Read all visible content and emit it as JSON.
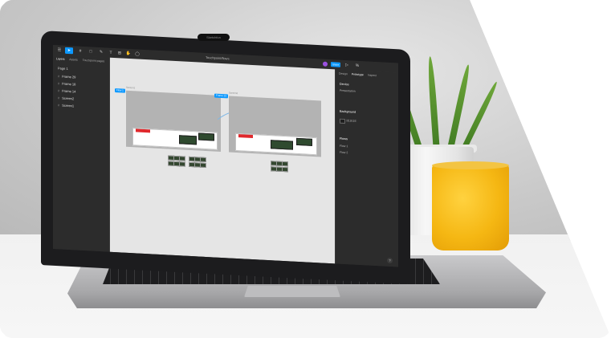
{
  "figma": {
    "camera_label": "Sketchfun",
    "document_title": "Touchpoint/flows",
    "share_label": "Share",
    "left_tabs": [
      "Layers",
      "Assets",
      "Touchpoint pages"
    ],
    "page_name": "Page 1",
    "layers": [
      "Frame 29",
      "Frame 18",
      "Frame 14",
      "Screen2",
      "Screen1"
    ],
    "right_tabs": [
      "Design",
      "Prototype",
      "Inspect"
    ],
    "device_label": "Device",
    "device_value": "Presentation",
    "background_label": "Background",
    "background_value": "1E1E1E",
    "flows_label": "Flows",
    "flows": [
      "Flow 1",
      "Flow 2"
    ],
    "frame_labels": [
      "Screen1",
      "Screen2"
    ],
    "selection_tags": [
      "Flow 1",
      "Frame 13"
    ],
    "help_label": "?"
  }
}
